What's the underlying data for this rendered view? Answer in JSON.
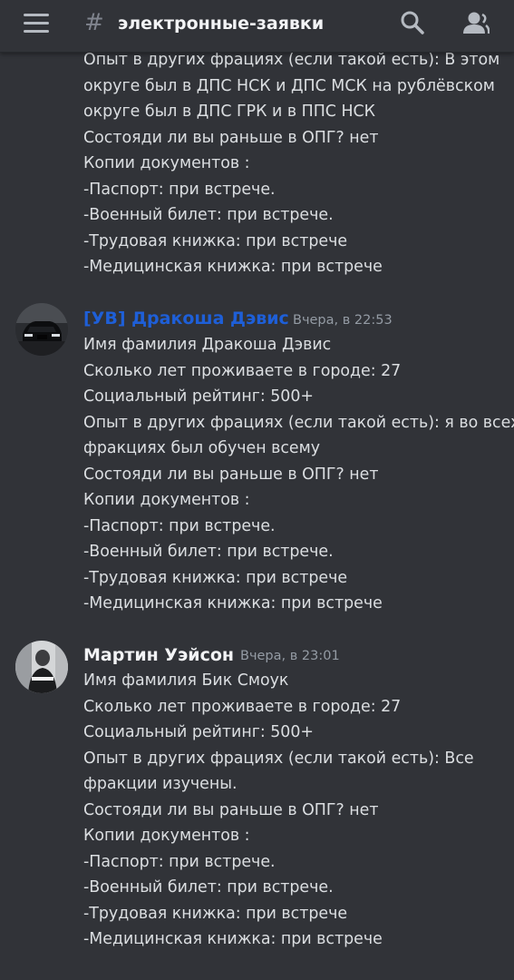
{
  "header": {
    "channel_name": "электронные-заявки",
    "icons": [
      "menu-icon",
      "hash-icon",
      "search-icon",
      "members-icon"
    ]
  },
  "colors": {
    "background": "#313338",
    "role_blue": "#1e5fd8",
    "username_default": "#f2f3f5",
    "timestamp": "#949ba4"
  },
  "continued_message": {
    "lines": [
      "Опыт в других фрациях (если такой есть): В этом",
      "округе был в ДПС НСК и ДПС МСК на рублёвском",
      "округе был в ДПС ГРК и в ППС НСК",
      "Состояди ли вы раньше в ОПГ? нет",
      "Копии документов :",
      "-Паспорт: при встрече.",
      "-Военный билет: при встрече.",
      "-Трудовая книжка: при встрече",
      "-Медицинская книжка: при встрече"
    ]
  },
  "messages": [
    {
      "author": "[УВ] Дракоша Дэвис",
      "timestamp": "Вчера, в 22:53",
      "lines": [
        "Имя фамилия Дракоша Дэвис",
        "Сколько лет проживаете в городе: 27",
        "Социальный рейтинг: 500+",
        "Опыт в других фрациях (если такой есть): я во всех",
        "фракциях был обучен всему",
        "Состояди ли вы раньше в ОПГ? нет",
        "Копии документов :",
        "-Паспорт: при встрече.",
        "-Военный билет: при встрече.",
        "-Трудовая книжка: при встрече",
        "-Медицинская книжка: при встрече"
      ]
    },
    {
      "author": "Мартин Уэйсон",
      "timestamp": "Вчера, в 23:01",
      "lines": [
        "Имя фамилия Бик Смоук",
        "Сколько лет проживаете в городе: 27",
        "Социальный рейтинг: 500+",
        "Опыт в других фрациях (если такой есть): Все",
        "фракции изучены.",
        "Состояди ли вы раньше в ОПГ? нет",
        "Копии документов :",
        "-Паспорт: при встрече.",
        "-Военный билет: при встрече.",
        "-Трудовая книжка: при встрече",
        "-Медицинская книжка: при встрече"
      ]
    }
  ]
}
